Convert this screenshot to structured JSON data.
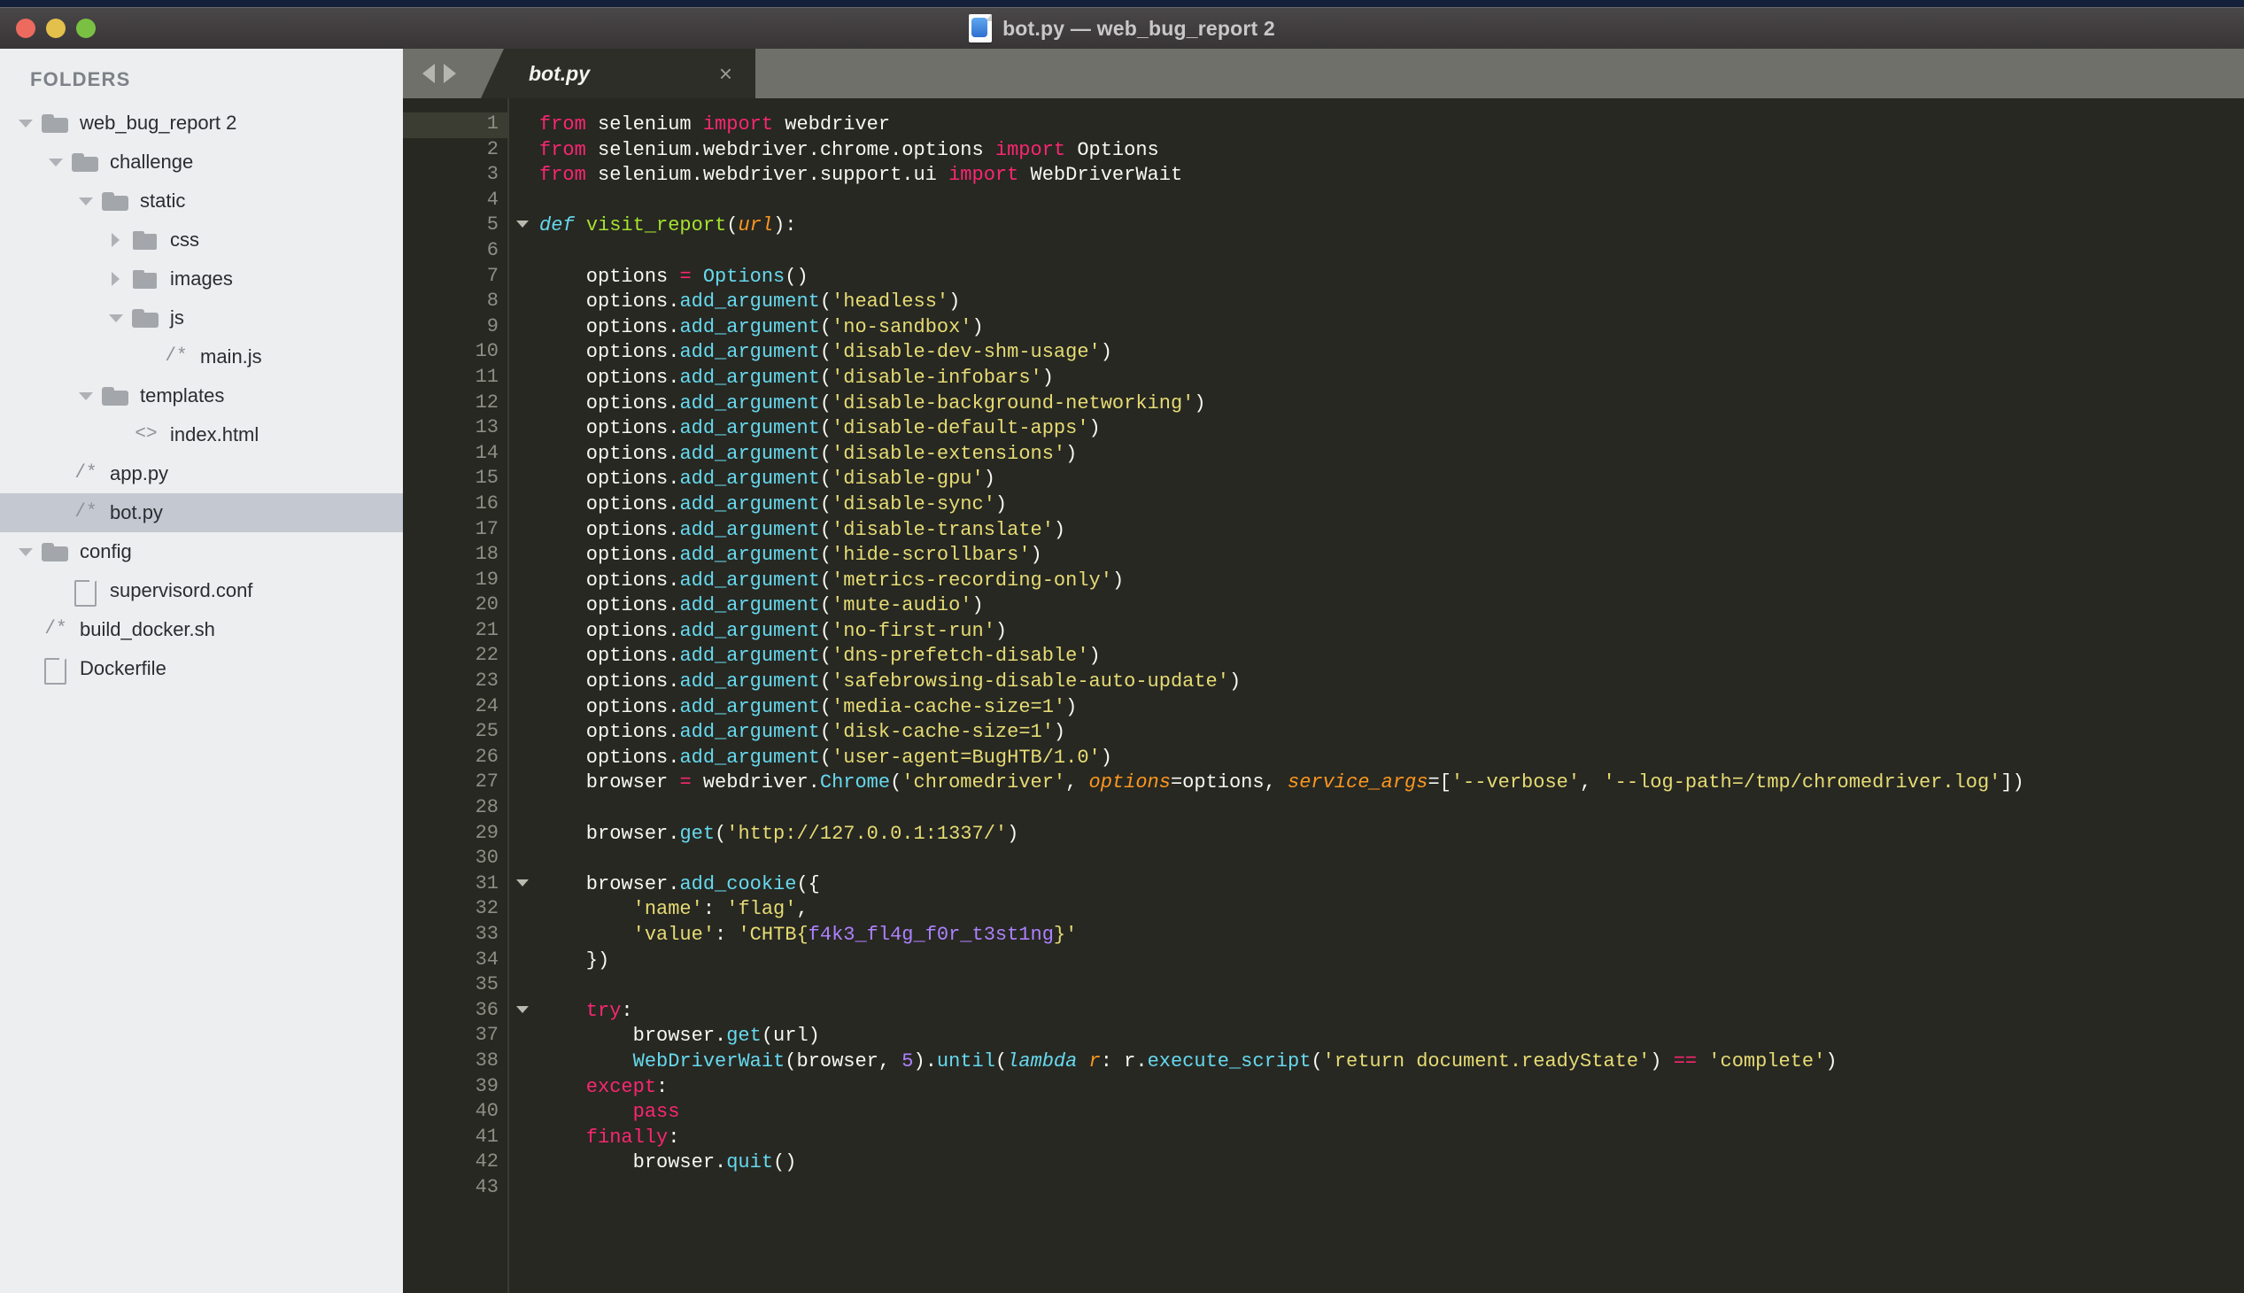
{
  "window": {
    "title": "bot.py — web_bug_report 2",
    "traffic_lights": [
      "close",
      "minimize",
      "zoom"
    ],
    "colors": {
      "close": "#ec6a5e",
      "minimize": "#e3c04c",
      "zoom": "#7ac143"
    }
  },
  "sidebar": {
    "heading": "FOLDERS",
    "items": [
      {
        "label": "web_bug_report 2",
        "indent": 1,
        "arrow": "down",
        "icon": "folder-open",
        "selected": false
      },
      {
        "label": "challenge",
        "indent": 2,
        "arrow": "down",
        "icon": "folder-open",
        "selected": false
      },
      {
        "label": "static",
        "indent": 3,
        "arrow": "down",
        "icon": "folder-open",
        "selected": false
      },
      {
        "label": "css",
        "indent": 4,
        "arrow": "right",
        "icon": "folder-closed",
        "selected": false
      },
      {
        "label": "images",
        "indent": 4,
        "arrow": "right",
        "icon": "folder-closed",
        "selected": false
      },
      {
        "label": "js",
        "indent": 4,
        "arrow": "down",
        "icon": "folder-open",
        "selected": false
      },
      {
        "label": "main.js",
        "indent": 5,
        "arrow": "none",
        "icon": "file-code",
        "selected": false
      },
      {
        "label": "templates",
        "indent": 3,
        "arrow": "down",
        "icon": "folder-open",
        "selected": false
      },
      {
        "label": "index.html",
        "indent": 4,
        "arrow": "none",
        "icon": "file-html",
        "selected": false
      },
      {
        "label": "app.py",
        "indent": 2,
        "arrow": "none",
        "icon": "file-code",
        "selected": false
      },
      {
        "label": "bot.py",
        "indent": 2,
        "arrow": "none",
        "icon": "file-code",
        "selected": true
      },
      {
        "label": "config",
        "indent": 1,
        "arrow": "down",
        "icon": "folder-open",
        "selected": false
      },
      {
        "label": "supervisord.conf",
        "indent": 2,
        "arrow": "none",
        "icon": "file-page",
        "selected": false
      },
      {
        "label": "build_docker.sh",
        "indent": 1,
        "arrow": "none",
        "icon": "file-code",
        "selected": false
      },
      {
        "label": "Dockerfile",
        "indent": 1,
        "arrow": "none",
        "icon": "file-page",
        "selected": false
      }
    ],
    "icon_glyphs": {
      "file-code": "/*",
      "file-html": "<>"
    }
  },
  "editor": {
    "nav_back_icon": "triangle-left-icon",
    "nav_forward_icon": "triangle-right-icon",
    "tab": {
      "label": "bot.py",
      "close_glyph": "×",
      "active": true
    },
    "current_line": 1,
    "fold_lines": [
      5,
      31,
      36
    ],
    "total_lines": 43,
    "lines": [
      {
        "n": 1,
        "tokens": [
          {
            "t": "from ",
            "c": "k"
          },
          {
            "t": "selenium ",
            "c": "wh"
          },
          {
            "t": "import ",
            "c": "k"
          },
          {
            "t": "webdriver",
            "c": "wh"
          }
        ]
      },
      {
        "n": 2,
        "tokens": [
          {
            "t": "from ",
            "c": "k"
          },
          {
            "t": "selenium.webdriver.chrome.options ",
            "c": "wh"
          },
          {
            "t": "import ",
            "c": "k"
          },
          {
            "t": "Options",
            "c": "wh"
          }
        ]
      },
      {
        "n": 3,
        "tokens": [
          {
            "t": "from ",
            "c": "k"
          },
          {
            "t": "selenium.webdriver.support.ui ",
            "c": "wh"
          },
          {
            "t": "import ",
            "c": "k"
          },
          {
            "t": "WebDriverWait",
            "c": "wh"
          }
        ]
      },
      {
        "n": 4,
        "tokens": []
      },
      {
        "n": 5,
        "tokens": [
          {
            "t": "def ",
            "c": "kw"
          },
          {
            "t": "visit_report",
            "c": "fn"
          },
          {
            "t": "(",
            "c": "wh"
          },
          {
            "t": "url",
            "c": "pm"
          },
          {
            "t": "):",
            "c": "wh"
          }
        ]
      },
      {
        "n": 6,
        "tokens": []
      },
      {
        "n": 7,
        "tokens": [
          {
            "t": "    options ",
            "c": "wh"
          },
          {
            "t": "= ",
            "c": "k"
          },
          {
            "t": "Options",
            "c": "cy"
          },
          {
            "t": "()",
            "c": "wh"
          }
        ]
      },
      {
        "n": 8,
        "tokens": [
          {
            "t": "    options.",
            "c": "wh"
          },
          {
            "t": "add_argument",
            "c": "cy"
          },
          {
            "t": "(",
            "c": "wh"
          },
          {
            "t": "'headless'",
            "c": "st"
          },
          {
            "t": ")",
            "c": "wh"
          }
        ]
      },
      {
        "n": 9,
        "tokens": [
          {
            "t": "    options.",
            "c": "wh"
          },
          {
            "t": "add_argument",
            "c": "cy"
          },
          {
            "t": "(",
            "c": "wh"
          },
          {
            "t": "'no-sandbox'",
            "c": "st"
          },
          {
            "t": ")",
            "c": "wh"
          }
        ]
      },
      {
        "n": 10,
        "tokens": [
          {
            "t": "    options.",
            "c": "wh"
          },
          {
            "t": "add_argument",
            "c": "cy"
          },
          {
            "t": "(",
            "c": "wh"
          },
          {
            "t": "'disable-dev-shm-usage'",
            "c": "st"
          },
          {
            "t": ")",
            "c": "wh"
          }
        ]
      },
      {
        "n": 11,
        "tokens": [
          {
            "t": "    options.",
            "c": "wh"
          },
          {
            "t": "add_argument",
            "c": "cy"
          },
          {
            "t": "(",
            "c": "wh"
          },
          {
            "t": "'disable-infobars'",
            "c": "st"
          },
          {
            "t": ")",
            "c": "wh"
          }
        ]
      },
      {
        "n": 12,
        "tokens": [
          {
            "t": "    options.",
            "c": "wh"
          },
          {
            "t": "add_argument",
            "c": "cy"
          },
          {
            "t": "(",
            "c": "wh"
          },
          {
            "t": "'disable-background-networking'",
            "c": "st"
          },
          {
            "t": ")",
            "c": "wh"
          }
        ]
      },
      {
        "n": 13,
        "tokens": [
          {
            "t": "    options.",
            "c": "wh"
          },
          {
            "t": "add_argument",
            "c": "cy"
          },
          {
            "t": "(",
            "c": "wh"
          },
          {
            "t": "'disable-default-apps'",
            "c": "st"
          },
          {
            "t": ")",
            "c": "wh"
          }
        ]
      },
      {
        "n": 14,
        "tokens": [
          {
            "t": "    options.",
            "c": "wh"
          },
          {
            "t": "add_argument",
            "c": "cy"
          },
          {
            "t": "(",
            "c": "wh"
          },
          {
            "t": "'disable-extensions'",
            "c": "st"
          },
          {
            "t": ")",
            "c": "wh"
          }
        ]
      },
      {
        "n": 15,
        "tokens": [
          {
            "t": "    options.",
            "c": "wh"
          },
          {
            "t": "add_argument",
            "c": "cy"
          },
          {
            "t": "(",
            "c": "wh"
          },
          {
            "t": "'disable-gpu'",
            "c": "st"
          },
          {
            "t": ")",
            "c": "wh"
          }
        ]
      },
      {
        "n": 16,
        "tokens": [
          {
            "t": "    options.",
            "c": "wh"
          },
          {
            "t": "add_argument",
            "c": "cy"
          },
          {
            "t": "(",
            "c": "wh"
          },
          {
            "t": "'disable-sync'",
            "c": "st"
          },
          {
            "t": ")",
            "c": "wh"
          }
        ]
      },
      {
        "n": 17,
        "tokens": [
          {
            "t": "    options.",
            "c": "wh"
          },
          {
            "t": "add_argument",
            "c": "cy"
          },
          {
            "t": "(",
            "c": "wh"
          },
          {
            "t": "'disable-translate'",
            "c": "st"
          },
          {
            "t": ")",
            "c": "wh"
          }
        ]
      },
      {
        "n": 18,
        "tokens": [
          {
            "t": "    options.",
            "c": "wh"
          },
          {
            "t": "add_argument",
            "c": "cy"
          },
          {
            "t": "(",
            "c": "wh"
          },
          {
            "t": "'hide-scrollbars'",
            "c": "st"
          },
          {
            "t": ")",
            "c": "wh"
          }
        ]
      },
      {
        "n": 19,
        "tokens": [
          {
            "t": "    options.",
            "c": "wh"
          },
          {
            "t": "add_argument",
            "c": "cy"
          },
          {
            "t": "(",
            "c": "wh"
          },
          {
            "t": "'metrics-recording-only'",
            "c": "st"
          },
          {
            "t": ")",
            "c": "wh"
          }
        ]
      },
      {
        "n": 20,
        "tokens": [
          {
            "t": "    options.",
            "c": "wh"
          },
          {
            "t": "add_argument",
            "c": "cy"
          },
          {
            "t": "(",
            "c": "wh"
          },
          {
            "t": "'mute-audio'",
            "c": "st"
          },
          {
            "t": ")",
            "c": "wh"
          }
        ]
      },
      {
        "n": 21,
        "tokens": [
          {
            "t": "    options.",
            "c": "wh"
          },
          {
            "t": "add_argument",
            "c": "cy"
          },
          {
            "t": "(",
            "c": "wh"
          },
          {
            "t": "'no-first-run'",
            "c": "st"
          },
          {
            "t": ")",
            "c": "wh"
          }
        ]
      },
      {
        "n": 22,
        "tokens": [
          {
            "t": "    options.",
            "c": "wh"
          },
          {
            "t": "add_argument",
            "c": "cy"
          },
          {
            "t": "(",
            "c": "wh"
          },
          {
            "t": "'dns-prefetch-disable'",
            "c": "st"
          },
          {
            "t": ")",
            "c": "wh"
          }
        ]
      },
      {
        "n": 23,
        "tokens": [
          {
            "t": "    options.",
            "c": "wh"
          },
          {
            "t": "add_argument",
            "c": "cy"
          },
          {
            "t": "(",
            "c": "wh"
          },
          {
            "t": "'safebrowsing-disable-auto-update'",
            "c": "st"
          },
          {
            "t": ")",
            "c": "wh"
          }
        ]
      },
      {
        "n": 24,
        "tokens": [
          {
            "t": "    options.",
            "c": "wh"
          },
          {
            "t": "add_argument",
            "c": "cy"
          },
          {
            "t": "(",
            "c": "wh"
          },
          {
            "t": "'media-cache-size=1'",
            "c": "st"
          },
          {
            "t": ")",
            "c": "wh"
          }
        ]
      },
      {
        "n": 25,
        "tokens": [
          {
            "t": "    options.",
            "c": "wh"
          },
          {
            "t": "add_argument",
            "c": "cy"
          },
          {
            "t": "(",
            "c": "wh"
          },
          {
            "t": "'disk-cache-size=1'",
            "c": "st"
          },
          {
            "t": ")",
            "c": "wh"
          }
        ]
      },
      {
        "n": 26,
        "tokens": [
          {
            "t": "    options.",
            "c": "wh"
          },
          {
            "t": "add_argument",
            "c": "cy"
          },
          {
            "t": "(",
            "c": "wh"
          },
          {
            "t": "'user-agent=BugHTB/1.0'",
            "c": "st"
          },
          {
            "t": ")",
            "c": "wh"
          }
        ]
      },
      {
        "n": 27,
        "tokens": [
          {
            "t": "    browser ",
            "c": "wh"
          },
          {
            "t": "= ",
            "c": "k"
          },
          {
            "t": "webdriver.",
            "c": "wh"
          },
          {
            "t": "Chrome",
            "c": "cy"
          },
          {
            "t": "(",
            "c": "wh"
          },
          {
            "t": "'chromedriver'",
            "c": "st"
          },
          {
            "t": ", ",
            "c": "wh"
          },
          {
            "t": "options",
            "c": "pm"
          },
          {
            "t": "=options, ",
            "c": "wh"
          },
          {
            "t": "service_args",
            "c": "pm"
          },
          {
            "t": "=[",
            "c": "wh"
          },
          {
            "t": "'--verbose'",
            "c": "st"
          },
          {
            "t": ", ",
            "c": "wh"
          },
          {
            "t": "'--log-path=/tmp/chromedriver.log'",
            "c": "st"
          },
          {
            "t": "])",
            "c": "wh"
          }
        ]
      },
      {
        "n": 28,
        "tokens": []
      },
      {
        "n": 29,
        "tokens": [
          {
            "t": "    browser.",
            "c": "wh"
          },
          {
            "t": "get",
            "c": "cy"
          },
          {
            "t": "(",
            "c": "wh"
          },
          {
            "t": "'http://127.0.0.1:1337/'",
            "c": "st"
          },
          {
            "t": ")",
            "c": "wh"
          }
        ]
      },
      {
        "n": 30,
        "tokens": []
      },
      {
        "n": 31,
        "tokens": [
          {
            "t": "    browser.",
            "c": "wh"
          },
          {
            "t": "add_cookie",
            "c": "cy"
          },
          {
            "t": "({",
            "c": "wh"
          }
        ]
      },
      {
        "n": 32,
        "tokens": [
          {
            "t": "        ",
            "c": "wh"
          },
          {
            "t": "'name'",
            "c": "st"
          },
          {
            "t": ": ",
            "c": "wh"
          },
          {
            "t": "'flag'",
            "c": "st"
          },
          {
            "t": ",",
            "c": "wh"
          }
        ]
      },
      {
        "n": 33,
        "tokens": [
          {
            "t": "        ",
            "c": "wh"
          },
          {
            "t": "'value'",
            "c": "st"
          },
          {
            "t": ": ",
            "c": "wh"
          },
          {
            "t": "'CHTB{",
            "c": "st"
          },
          {
            "t": "f4k3_fl4g_f0r_t3st1ng",
            "c": "nu"
          },
          {
            "t": "}'",
            "c": "st"
          }
        ]
      },
      {
        "n": 34,
        "tokens": [
          {
            "t": "    })",
            "c": "wh"
          }
        ]
      },
      {
        "n": 35,
        "tokens": []
      },
      {
        "n": 36,
        "tokens": [
          {
            "t": "    try",
            "c": "k"
          },
          {
            "t": ":",
            "c": "wh"
          }
        ]
      },
      {
        "n": 37,
        "tokens": [
          {
            "t": "        browser.",
            "c": "wh"
          },
          {
            "t": "get",
            "c": "cy"
          },
          {
            "t": "(url)",
            "c": "wh"
          }
        ]
      },
      {
        "n": 38,
        "tokens": [
          {
            "t": "        ",
            "c": "wh"
          },
          {
            "t": "WebDriverWait",
            "c": "cy"
          },
          {
            "t": "(browser, ",
            "c": "wh"
          },
          {
            "t": "5",
            "c": "nu"
          },
          {
            "t": ").",
            "c": "wh"
          },
          {
            "t": "until",
            "c": "cy"
          },
          {
            "t": "(",
            "c": "wh"
          },
          {
            "t": "lambda ",
            "c": "kw"
          },
          {
            "t": "r",
            "c": "pm"
          },
          {
            "t": ": r.",
            "c": "wh"
          },
          {
            "t": "execute_script",
            "c": "cy"
          },
          {
            "t": "(",
            "c": "wh"
          },
          {
            "t": "'return document.readyState'",
            "c": "st"
          },
          {
            "t": ") ",
            "c": "wh"
          },
          {
            "t": "== ",
            "c": "k"
          },
          {
            "t": "'complete'",
            "c": "st"
          },
          {
            "t": ")",
            "c": "wh"
          }
        ]
      },
      {
        "n": 39,
        "tokens": [
          {
            "t": "    except",
            "c": "k"
          },
          {
            "t": ":",
            "c": "wh"
          }
        ]
      },
      {
        "n": 40,
        "tokens": [
          {
            "t": "        ",
            "c": "wh"
          },
          {
            "t": "pass",
            "c": "k"
          }
        ]
      },
      {
        "n": 41,
        "tokens": [
          {
            "t": "    finally",
            "c": "k"
          },
          {
            "t": ":",
            "c": "wh"
          }
        ]
      },
      {
        "n": 42,
        "tokens": [
          {
            "t": "        browser.",
            "c": "wh"
          },
          {
            "t": "quit",
            "c": "cy"
          },
          {
            "t": "()",
            "c": "wh"
          }
        ]
      },
      {
        "n": 43,
        "tokens": []
      }
    ],
    "theme": {
      "background": "#272822",
      "foreground": "#f8f8f2",
      "keyword": "#f92672",
      "function": "#a6e22e",
      "class": "#66d9ef",
      "string": "#e6db74",
      "number": "#ae81ff",
      "parameter": "#fd971f",
      "gutter_text": "#8e8e85",
      "current_line": "#3b3c32"
    }
  }
}
